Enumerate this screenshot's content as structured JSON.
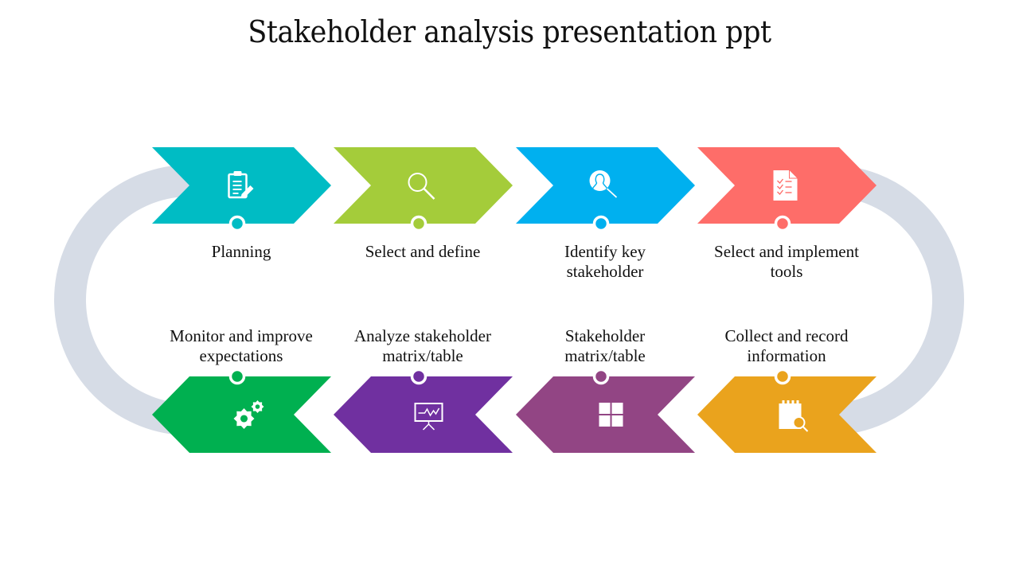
{
  "title": "Stakeholder analysis presentation ppt",
  "ring_color": "#d6dce6",
  "top_steps": [
    {
      "label": "Planning",
      "color": "#00bcc4",
      "icon": "clipboard-pencil-icon"
    },
    {
      "label": "Select and define",
      "color": "#a4cc3a",
      "icon": "magnifier-icon"
    },
    {
      "label": "Identify key\nstakeholder",
      "color": "#00b0ef",
      "icon": "person-search-icon"
    },
    {
      "label": "Select and implement\ntools",
      "color": "#fe6d69",
      "icon": "checklist-document-icon"
    }
  ],
  "bottom_steps": [
    {
      "label": "Monitor and improve\nexpectations",
      "color": "#00b050",
      "icon": "gears-icon"
    },
    {
      "label": "Analyze stakeholder\nmatrix/table",
      "color": "#7030a0",
      "icon": "presentation-chart-icon"
    },
    {
      "label": "Stakeholder\nmatrix/table",
      "color": "#924584",
      "icon": "grid-icon"
    },
    {
      "label": "Collect and record\ninformation",
      "color": "#eaa31d",
      "icon": "notepad-search-icon"
    }
  ]
}
